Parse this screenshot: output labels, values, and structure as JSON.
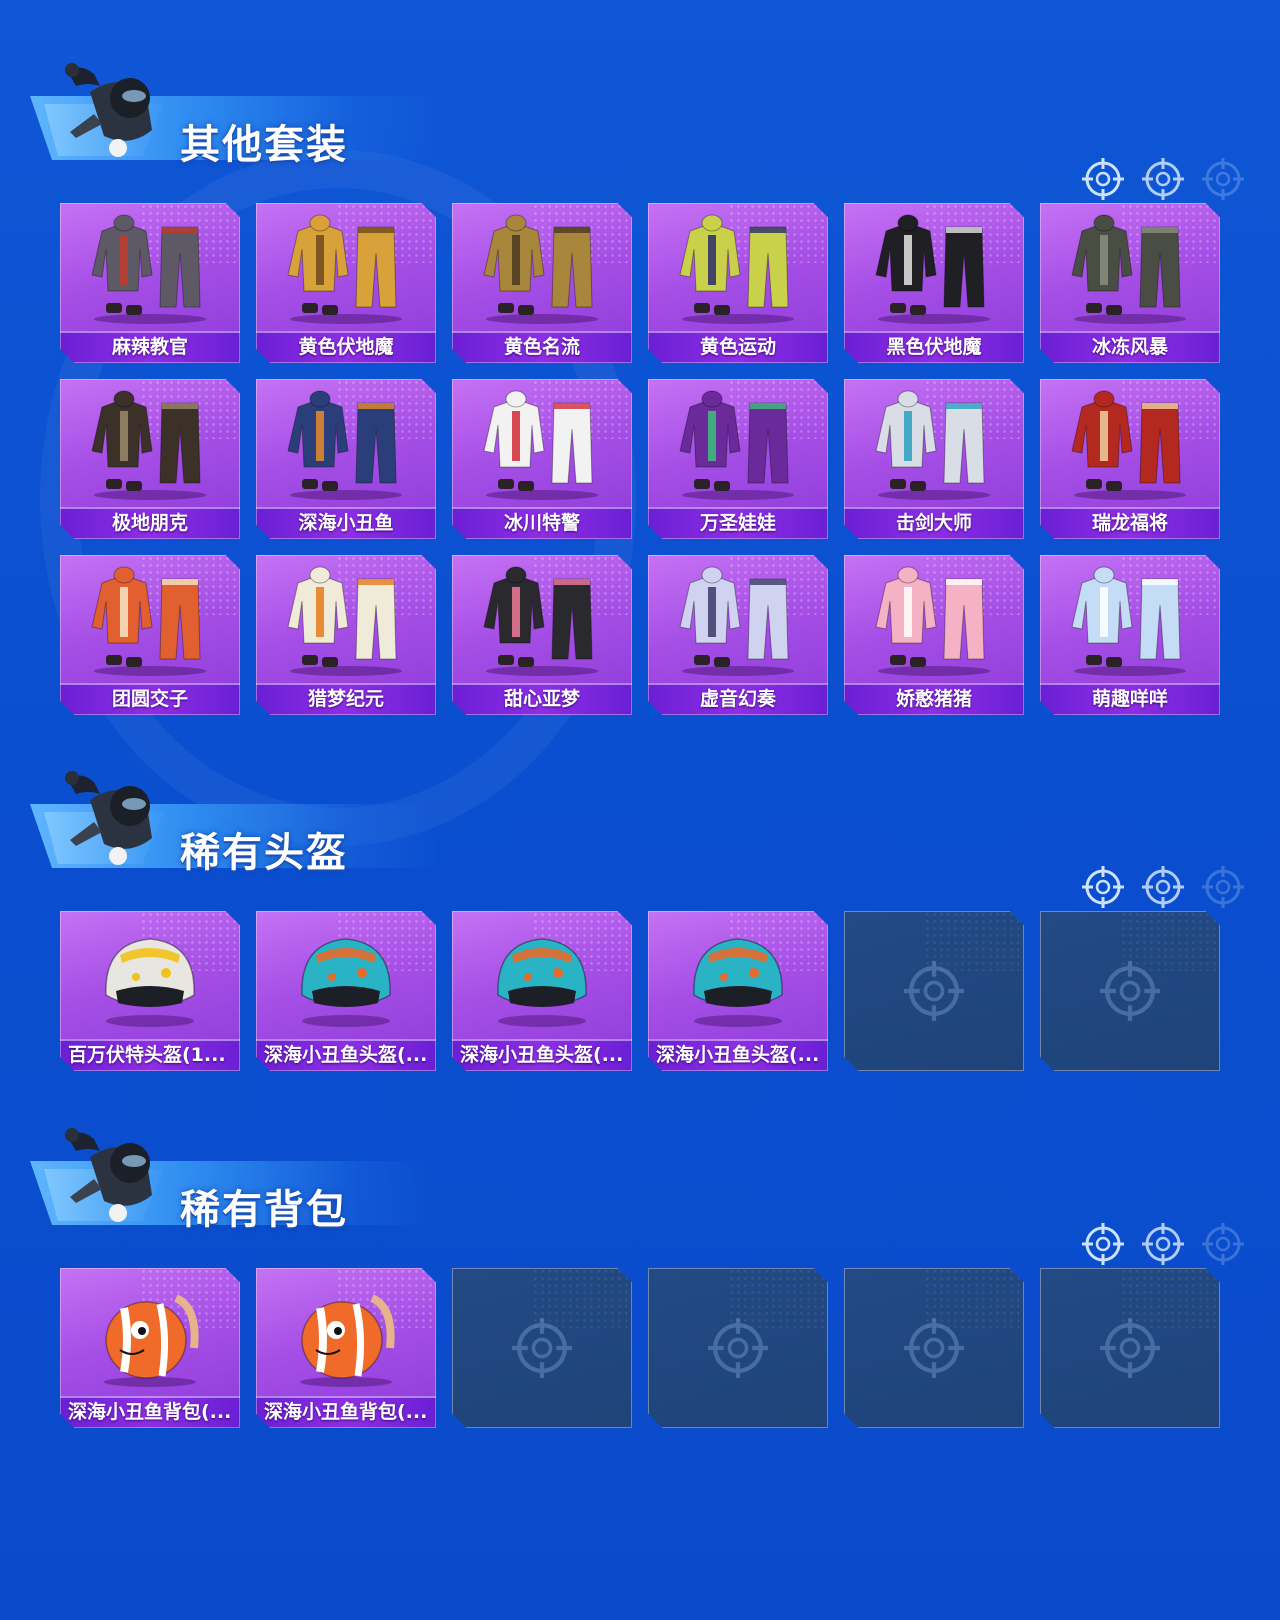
{
  "sections": [
    {
      "title": "其他套装",
      "items": [
        {
          "label": "麻辣教官",
          "color": "#5d5a66",
          "accent": "#c23a2a",
          "type": "outfit"
        },
        {
          "label": "黄色伏地魔",
          "color": "#d9a13a",
          "accent": "#6b4a1c",
          "type": "outfit"
        },
        {
          "label": "黄色名流",
          "color": "#a8863b",
          "accent": "#4a3a22",
          "type": "outfit"
        },
        {
          "label": "黄色运动",
          "color": "#c9d04a",
          "accent": "#2a2a6a",
          "type": "outfit"
        },
        {
          "label": "黑色伏地魔",
          "color": "#1f1f24",
          "accent": "#e5e5e5",
          "type": "outfit"
        },
        {
          "label": "冰冻风暴",
          "color": "#4a4d44",
          "accent": "#8a8f80",
          "type": "outfit"
        },
        {
          "label": "极地朋克",
          "color": "#3b3128",
          "accent": "#9c8a6a",
          "type": "outfit"
        },
        {
          "label": "深海小丑鱼",
          "color": "#2a3f7a",
          "accent": "#e88a2a",
          "type": "outfit"
        },
        {
          "label": "冰川特警",
          "color": "#f2f2f2",
          "accent": "#d22a3a",
          "type": "outfit"
        },
        {
          "label": "万圣娃娃",
          "color": "#6a2a9a",
          "accent": "#3bc17a",
          "type": "outfit"
        },
        {
          "label": "击剑大师",
          "color": "#d8dde6",
          "accent": "#2aa0c0",
          "type": "outfit"
        },
        {
          "label": "瑞龙福将",
          "color": "#b3281f",
          "accent": "#f0d0a0",
          "type": "outfit"
        },
        {
          "label": "团圆交子",
          "color": "#e2602f",
          "accent": "#f5e6c8",
          "type": "outfit"
        },
        {
          "label": "猎梦纪元",
          "color": "#f0ead8",
          "accent": "#e87a1a",
          "type": "outfit"
        },
        {
          "label": "甜心亚梦",
          "color": "#2a2a2e",
          "accent": "#f07a98",
          "type": "outfit"
        },
        {
          "label": "虚音幻奏",
          "color": "#cfd3f0",
          "accent": "#3a3a6a",
          "type": "outfit"
        },
        {
          "label": "娇憨猪猪",
          "color": "#f5b2c4",
          "accent": "#ffffff",
          "type": "outfit"
        },
        {
          "label": "萌趣咩咩",
          "color": "#c4dcf5",
          "accent": "#ffffff",
          "type": "outfit"
        }
      ]
    },
    {
      "title": "稀有头盔",
      "items": [
        {
          "label": "百万伏特头盔(1...",
          "color": "#e8e6e0",
          "accent": "#f2c21a",
          "type": "helmet"
        },
        {
          "label": "深海小丑鱼头盔(...",
          "color": "#2ab3c4",
          "accent": "#e86a2a",
          "type": "helmet"
        },
        {
          "label": "深海小丑鱼头盔(...",
          "color": "#2ab3c4",
          "accent": "#e86a2a",
          "type": "helmet"
        },
        {
          "label": "深海小丑鱼头盔(...",
          "color": "#2ab3c4",
          "accent": "#e86a2a",
          "type": "helmet"
        },
        {
          "empty": true
        },
        {
          "empty": true
        }
      ]
    },
    {
      "title": "稀有背包",
      "items": [
        {
          "label": "深海小丑鱼背包(...",
          "color": "#f06a2a",
          "accent": "#ffffff",
          "type": "backpack"
        },
        {
          "label": "深海小丑鱼背包(...",
          "color": "#f06a2a",
          "accent": "#ffffff",
          "type": "backpack"
        },
        {
          "empty": true
        },
        {
          "empty": true
        },
        {
          "empty": true
        },
        {
          "empty": true
        }
      ]
    }
  ]
}
